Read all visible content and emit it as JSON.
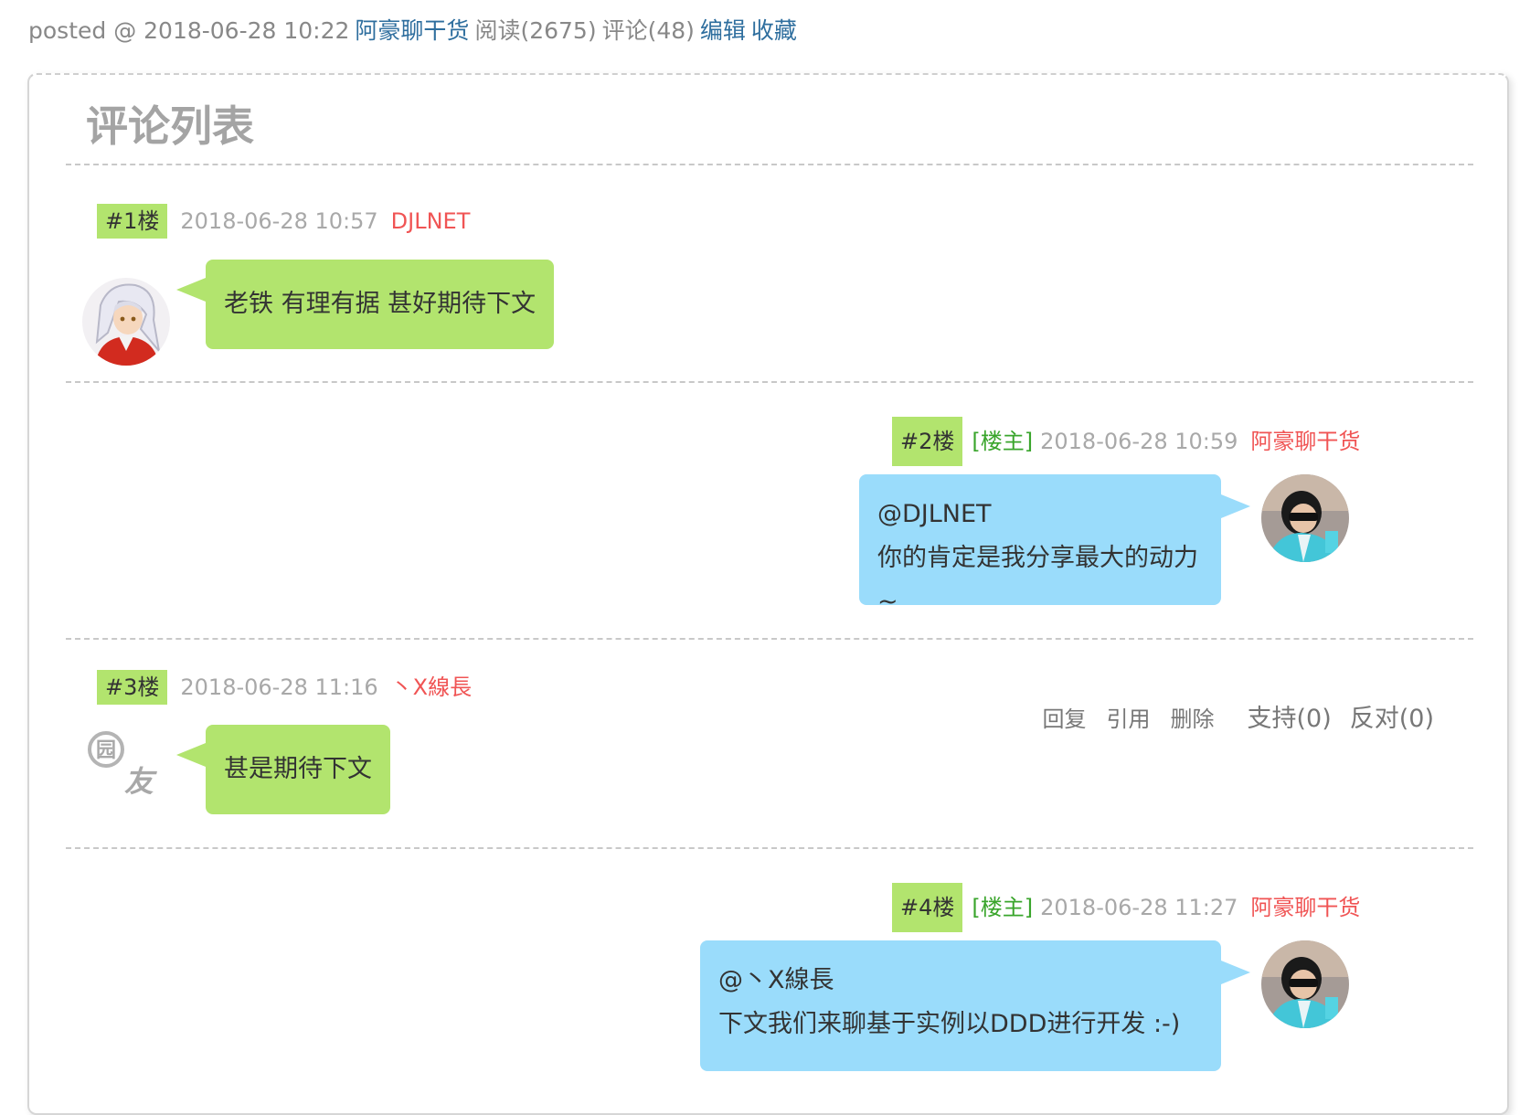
{
  "post_footer": {
    "posted": "posted @ 2018-06-28 10:22",
    "author": "阿豪聊干货",
    "reads": "阅读(2675)",
    "comments": "评论(48)",
    "edit": "编辑",
    "favorite": "收藏"
  },
  "comment_list": {
    "title": "评论列表",
    "items": [
      {
        "floor": "#1楼",
        "owner_tag": "",
        "time": "2018-06-28 10:57",
        "author": "DJLNET",
        "lines": [
          "老铁 有理有据 甚好期待下文"
        ],
        "avatar_icon": "inuyasha-avatar-icon"
      },
      {
        "floor": "#2楼",
        "owner_tag": "[楼主]",
        "time": "2018-06-28 10:59",
        "author": "阿豪聊干货",
        "lines": [
          "@DJLNET",
          "你的肯定是我分享最大的动力~"
        ],
        "avatar_icon": "sunglasses-man-avatar-icon"
      },
      {
        "floor": "#3楼",
        "owner_tag": "",
        "time": "2018-06-28 11:16",
        "author": "丶X線長",
        "lines": [
          "甚是期待下文"
        ],
        "avatar_icon": "default-yuanyou-avatar-icon",
        "avatar_text": [
          "园",
          "友"
        ],
        "actions": {
          "reply": "回复",
          "quote": "引用",
          "delete": "删除",
          "support": "支持(0)",
          "oppose": "反对(0)"
        }
      },
      {
        "floor": "#4楼",
        "owner_tag": "[楼主]",
        "time": "2018-06-28 11:27",
        "author": "阿豪聊干货",
        "lines": [
          "@丶X線長",
          "下文我们来聊基于实例以DDD进行开发 :-)"
        ],
        "avatar_icon": "sunglasses-man-avatar-icon"
      }
    ]
  },
  "colors": {
    "link": "#2e6e9e",
    "floor_badge": "#b2e46e",
    "blue_bubble": "#9adcfb",
    "author": "#f05454",
    "owner_tag": "#3aa52c"
  }
}
